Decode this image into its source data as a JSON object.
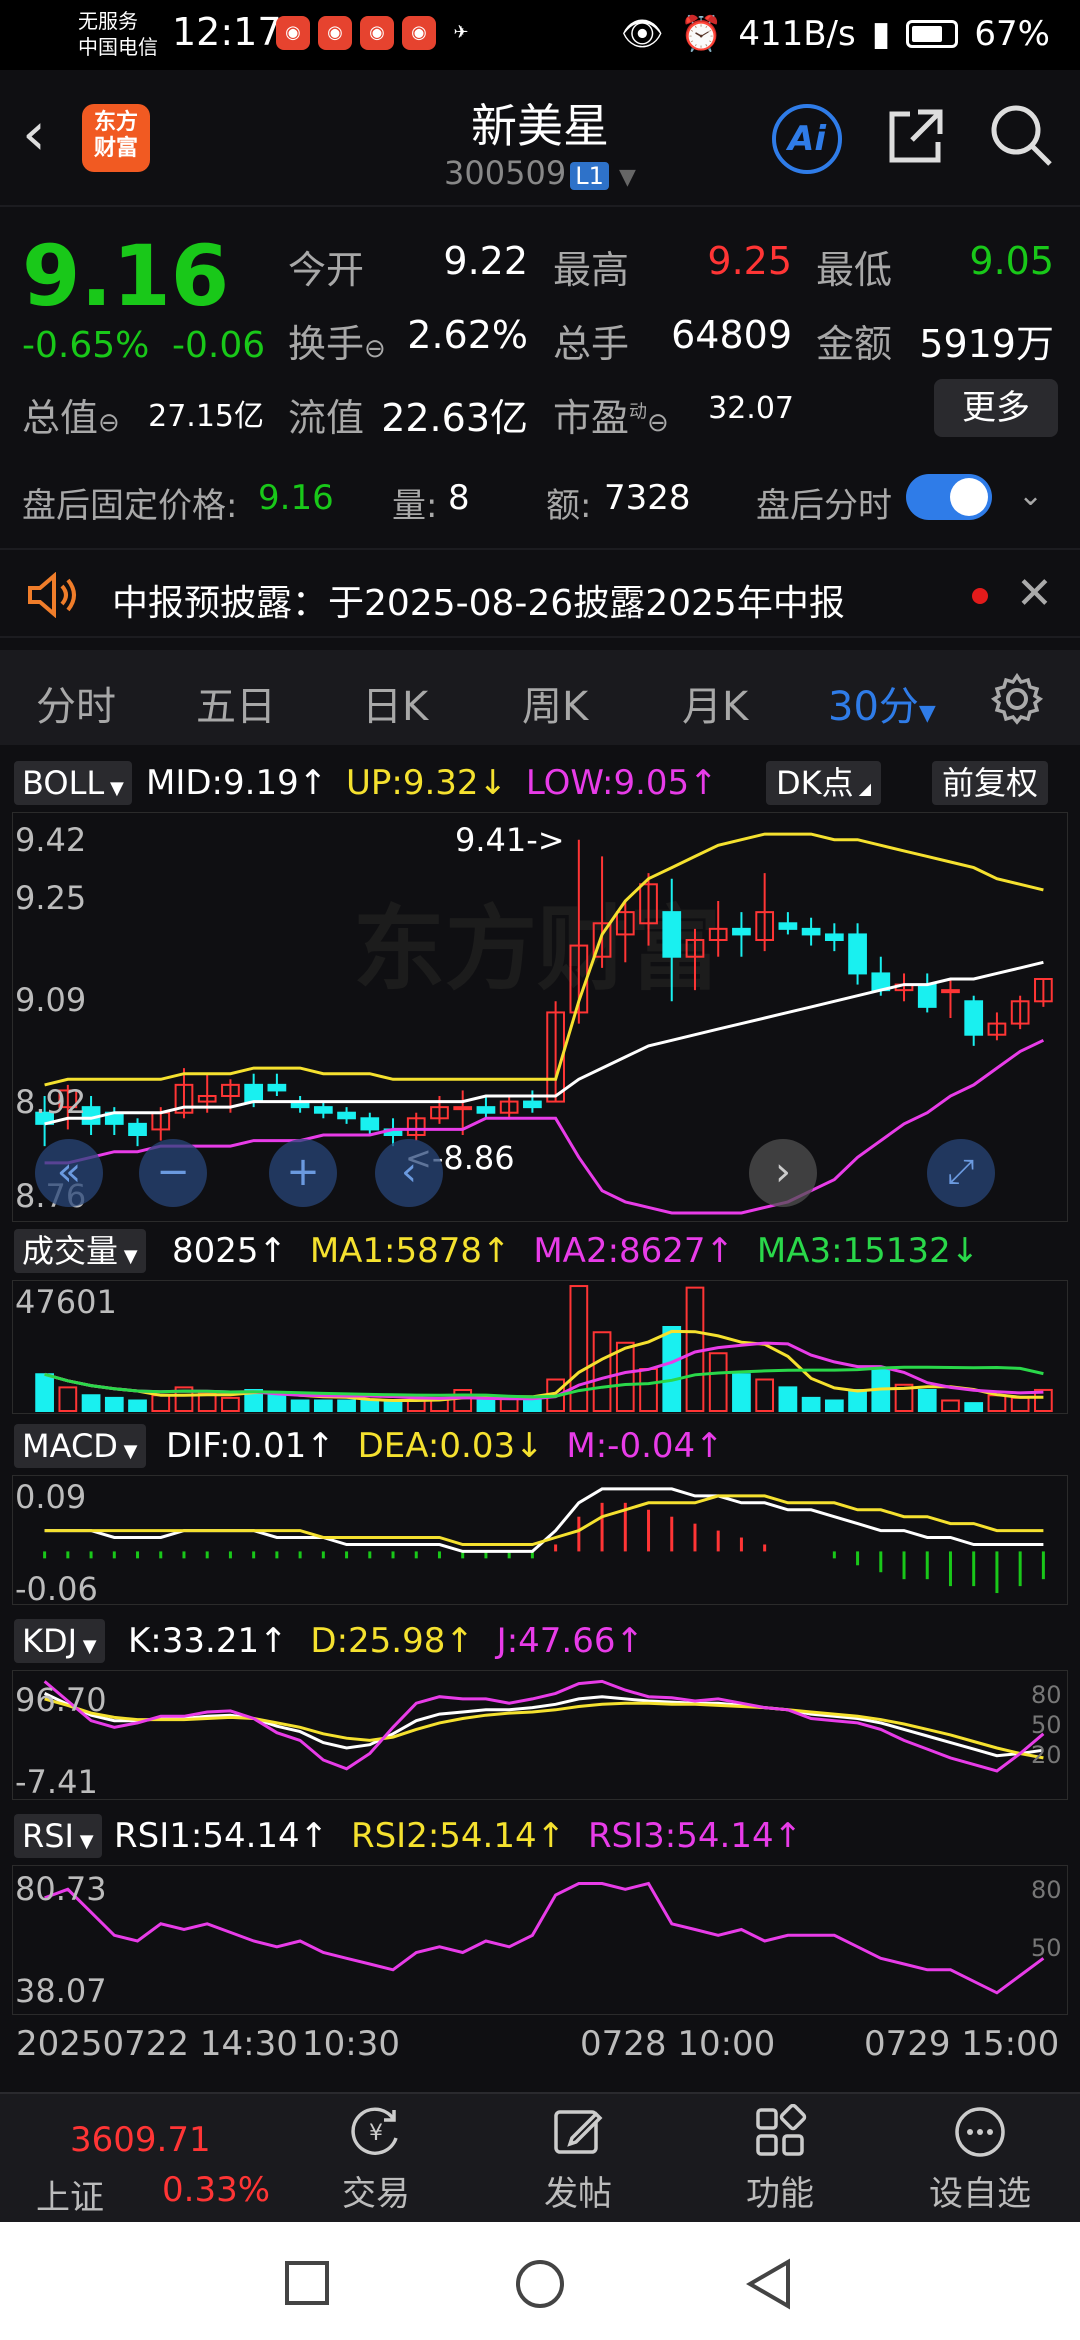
{
  "status_bar": {
    "carrier_line1": "无服务",
    "carrier_line2": "中国电信",
    "time": "12:17",
    "network_speed": "411B/s",
    "battery": "67%"
  },
  "header": {
    "logo_line1": "东方",
    "logo_line2": "财富",
    "stock_name": "新美星",
    "stock_code": "300509",
    "level_badge": "L1",
    "ai_label": "Ai"
  },
  "quote": {
    "price": "9.16",
    "change_pct": "-0.65%",
    "change_abs": "-0.06",
    "open_label": "今开",
    "open": "9.22",
    "high_label": "最高",
    "high": "9.25",
    "low_label": "最低",
    "low": "9.05",
    "turnover_label": "换手",
    "turnover": "2.62%",
    "volume_label": "总手",
    "volume": "64809",
    "amount_label": "金额",
    "amount": "5919万",
    "mktcap_label": "总值",
    "mktcap": "27.15亿",
    "float_label": "流值",
    "float": "22.63亿",
    "pe_label": "市盈",
    "pe_sup": "动",
    "pe": "32.07",
    "more": "更多"
  },
  "after_hours": {
    "price_label": "盘后固定价格:",
    "price": "9.16",
    "vol_label": "量:",
    "vol": "8",
    "amt_label": "额:",
    "amt": "7328",
    "toggle_label": "盘后分时"
  },
  "notice": {
    "text": "中报预披露：于2025-08-26披露2025年中报"
  },
  "tabs": [
    "分时",
    "五日",
    "日K",
    "周K",
    "月K",
    "30分"
  ],
  "boll": {
    "name": "BOLL",
    "mid": "MID:9.19↑",
    "up": "UP:9.32↓",
    "low": "LOW:9.05↑",
    "dk_btn": "DK点",
    "adjust_btn": "前复权",
    "y_ticks": [
      "9.42",
      "9.25",
      "9.09",
      "8.92",
      "8.76"
    ],
    "max_marker": "9.41->",
    "min_marker": "<-8.86",
    "watermark": "东方财富"
  },
  "volume": {
    "name": "成交量",
    "value": "8025↑",
    "ma1": "MA1:5878↑",
    "ma2": "MA2:8627↑",
    "ma3": "MA3:15132↓",
    "y_max": "47601"
  },
  "macd": {
    "name": "MACD",
    "dif": "DIF:0.01↑",
    "dea": "DEA:0.03↓",
    "m": "M:-0.04↑",
    "y_top": "0.09",
    "y_bottom": "-0.06"
  },
  "kdj": {
    "name": "KDJ",
    "k": "K:33.21↑",
    "d": "D:25.98↑",
    "j": "J:47.66↑",
    "y_top": "96.70",
    "y_bottom": "-7.41",
    "r80": "80",
    "r50": "50",
    "r20": "20"
  },
  "rsi": {
    "name": "RSI",
    "rsi1": "RSI1:54.14↑",
    "rsi2": "RSI2:54.14↑",
    "rsi3": "RSI3:54.14↑",
    "y_top": "80.73",
    "y_bottom": "38.07",
    "r80": "80",
    "r50": "50"
  },
  "time_axis": {
    "t1": "20250722 14:30",
    "t2": "10:30",
    "t3": "0728 10:00",
    "t4": "0729 15:00"
  },
  "bottom_bar": {
    "index_value": "3609.71",
    "index_name": "上证",
    "index_pct": "0.33%",
    "trade": "交易",
    "post": "发帖",
    "func": "功能",
    "custom": "设自选"
  },
  "colors": {
    "up": "#ff3535",
    "down": "#19c819",
    "accent": "#2f7ce8",
    "yellow": "#f5e12f",
    "magenta": "#e83ce8",
    "cyan": "#19f0f0"
  },
  "chart_data": {
    "type": "candlestick",
    "interval": "30分",
    "candles_ohlc": [
      [
        8.92,
        8.95,
        8.86,
        8.9
      ],
      [
        8.93,
        8.97,
        8.89,
        8.96
      ],
      [
        8.93,
        8.95,
        8.88,
        8.9
      ],
      [
        8.92,
        8.93,
        8.88,
        8.9
      ],
      [
        8.9,
        8.91,
        8.86,
        8.88
      ],
      [
        8.89,
        8.93,
        8.87,
        8.92
      ],
      [
        8.92,
        9.0,
        8.91,
        8.97
      ],
      [
        8.94,
        8.99,
        8.92,
        8.95
      ],
      [
        8.95,
        8.98,
        8.92,
        8.97
      ],
      [
        8.97,
        8.99,
        8.93,
        8.94
      ],
      [
        8.97,
        8.99,
        8.95,
        8.96
      ],
      [
        8.94,
        8.95,
        8.92,
        8.93
      ],
      [
        8.93,
        8.94,
        8.91,
        8.92
      ],
      [
        8.92,
        8.93,
        8.9,
        8.91
      ],
      [
        8.91,
        8.92,
        8.88,
        8.89
      ],
      [
        8.89,
        8.91,
        8.86,
        8.88
      ],
      [
        8.88,
        8.92,
        8.87,
        8.91
      ],
      [
        8.91,
        8.95,
        8.9,
        8.93
      ],
      [
        8.93,
        8.96,
        8.88,
        8.93
      ],
      [
        8.93,
        8.95,
        8.91,
        8.92
      ],
      [
        8.92,
        8.95,
        8.91,
        8.94
      ],
      [
        8.94,
        8.96,
        8.92,
        8.93
      ],
      [
        8.94,
        9.12,
        8.94,
        9.1
      ],
      [
        9.1,
        9.41,
        9.08,
        9.22
      ],
      [
        9.2,
        9.38,
        9.18,
        9.26
      ],
      [
        9.24,
        9.3,
        9.19,
        9.28
      ],
      [
        9.26,
        9.35,
        9.22,
        9.33
      ],
      [
        9.28,
        9.34,
        9.12,
        9.2
      ],
      [
        9.2,
        9.25,
        9.14,
        9.23
      ],
      [
        9.23,
        9.3,
        9.2,
        9.25
      ],
      [
        9.25,
        9.28,
        9.2,
        9.24
      ],
      [
        9.23,
        9.35,
        9.21,
        9.28
      ],
      [
        9.26,
        9.28,
        9.24,
        9.25
      ],
      [
        9.25,
        9.27,
        9.22,
        9.24
      ],
      [
        9.24,
        9.26,
        9.21,
        9.23
      ],
      [
        9.24,
        9.26,
        9.15,
        9.17
      ],
      [
        9.17,
        9.2,
        9.13,
        9.14
      ],
      [
        9.14,
        9.17,
        9.12,
        9.15
      ],
      [
        9.15,
        9.17,
        9.1,
        9.11
      ],
      [
        9.14,
        9.16,
        9.09,
        9.14
      ],
      [
        9.12,
        9.13,
        9.04,
        9.06
      ],
      [
        9.06,
        9.1,
        9.05,
        9.08
      ],
      [
        9.08,
        9.13,
        9.07,
        9.12
      ],
      [
        9.12,
        9.16,
        9.11,
        9.16
      ]
    ],
    "boll_mid": [
      8.9,
      8.91,
      8.91,
      8.92,
      8.92,
      8.92,
      8.93,
      8.93,
      8.93,
      8.94,
      8.94,
      8.94,
      8.94,
      8.94,
      8.94,
      8.94,
      8.94,
      8.94,
      8.94,
      8.95,
      8.95,
      8.95,
      8.95,
      8.98,
      9.0,
      9.02,
      9.04,
      9.05,
      9.06,
      9.07,
      9.08,
      9.09,
      9.1,
      9.11,
      9.12,
      9.13,
      9.14,
      9.15,
      9.15,
      9.16,
      9.16,
      9.17,
      9.18,
      9.19
    ],
    "boll_up": [
      8.97,
      8.98,
      8.98,
      8.98,
      8.98,
      8.98,
      8.99,
      8.99,
      8.99,
      9.0,
      9.0,
      9.0,
      8.99,
      8.99,
      8.99,
      8.98,
      8.98,
      8.98,
      8.98,
      8.98,
      8.98,
      8.98,
      8.98,
      9.12,
      9.24,
      9.3,
      9.34,
      9.36,
      9.38,
      9.4,
      9.41,
      9.42,
      9.42,
      9.42,
      9.41,
      9.41,
      9.4,
      9.39,
      9.38,
      9.37,
      9.36,
      9.34,
      9.33,
      9.32
    ],
    "boll_low": [
      8.83,
      8.83,
      8.84,
      8.85,
      8.85,
      8.86,
      8.86,
      8.86,
      8.86,
      8.87,
      8.87,
      8.87,
      8.88,
      8.88,
      8.88,
      8.89,
      8.89,
      8.89,
      8.89,
      8.91,
      8.91,
      8.91,
      8.91,
      8.84,
      8.78,
      8.76,
      8.75,
      8.74,
      8.74,
      8.74,
      8.74,
      8.75,
      8.76,
      8.78,
      8.8,
      8.84,
      8.87,
      8.9,
      8.92,
      8.95,
      8.97,
      9.0,
      9.03,
      9.05
    ],
    "volumes": [
      14000,
      9000,
      6000,
      5000,
      4000,
      6000,
      9000,
      7000,
      5000,
      8000,
      6000,
      4000,
      4000,
      4000,
      4000,
      4000,
      4000,
      5000,
      8000,
      5000,
      5000,
      4000,
      12000,
      47601,
      30000,
      26000,
      16000,
      32000,
      47000,
      22000,
      14000,
      12000,
      9000,
      5000,
      4000,
      8000,
      16000,
      10000,
      8000,
      4000,
      3000,
      6000,
      5000,
      8025
    ],
    "macd_hist": [
      -0.01,
      -0.01,
      -0.01,
      -0.01,
      -0.01,
      -0.01,
      -0.01,
      -0.01,
      -0.01,
      -0.01,
      -0.01,
      -0.01,
      -0.01,
      -0.01,
      -0.01,
      -0.01,
      -0.01,
      -0.01,
      -0.01,
      -0.01,
      -0.01,
      -0.01,
      0.01,
      0.05,
      0.07,
      0.07,
      0.06,
      0.05,
      0.04,
      0.03,
      0.02,
      0.01,
      0.0,
      0.0,
      -0.01,
      -0.02,
      -0.03,
      -0.04,
      -0.04,
      -0.05,
      -0.05,
      -0.06,
      -0.05,
      -0.04
    ],
    "macd_dif": [
      0.03,
      0.03,
      0.03,
      0.02,
      0.02,
      0.02,
      0.03,
      0.03,
      0.03,
      0.03,
      0.02,
      0.02,
      0.02,
      0.01,
      0.01,
      0.01,
      0.01,
      0.01,
      0.0,
      0.0,
      0.0,
      0.0,
      0.03,
      0.07,
      0.09,
      0.09,
      0.09,
      0.09,
      0.08,
      0.08,
      0.07,
      0.07,
      0.06,
      0.06,
      0.05,
      0.04,
      0.03,
      0.03,
      0.02,
      0.02,
      0.01,
      0.01,
      0.01,
      0.01
    ],
    "macd_dea": [
      0.03,
      0.03,
      0.03,
      0.03,
      0.03,
      0.03,
      0.03,
      0.03,
      0.03,
      0.03,
      0.03,
      0.03,
      0.02,
      0.02,
      0.02,
      0.02,
      0.02,
      0.02,
      0.01,
      0.01,
      0.01,
      0.01,
      0.02,
      0.03,
      0.05,
      0.06,
      0.07,
      0.07,
      0.07,
      0.08,
      0.08,
      0.08,
      0.07,
      0.07,
      0.07,
      0.06,
      0.06,
      0.05,
      0.05,
      0.04,
      0.04,
      0.03,
      0.03,
      0.03
    ],
    "kdj_k": [
      85,
      75,
      65,
      60,
      60,
      62,
      62,
      64,
      65,
      62,
      55,
      50,
      40,
      35,
      38,
      48,
      60,
      66,
      68,
      70,
      70,
      72,
      75,
      80,
      82,
      80,
      78,
      77,
      76,
      76,
      74,
      72,
      70,
      66,
      64,
      62,
      58,
      52,
      46,
      40,
      34,
      28,
      30,
      33
    ],
    "kdj_d": [
      80,
      74,
      67,
      63,
      61,
      61,
      61,
      62,
      63,
      62,
      58,
      54,
      48,
      44,
      42,
      45,
      52,
      58,
      62,
      65,
      67,
      68,
      70,
      73,
      75,
      76,
      76,
      75,
      75,
      74,
      73,
      72,
      70,
      68,
      66,
      64,
      61,
      57,
      52,
      47,
      41,
      35,
      30,
      26
    ],
    "kdj_j": [
      96,
      78,
      60,
      54,
      58,
      64,
      64,
      68,
      69,
      62,
      49,
      42,
      24,
      16,
      30,
      54,
      76,
      82,
      80,
      80,
      76,
      80,
      85,
      94,
      96,
      88,
      82,
      81,
      78,
      80,
      76,
      72,
      70,
      62,
      60,
      58,
      52,
      42,
      34,
      26,
      20,
      14,
      30,
      48
    ],
    "rsi": [
      75,
      78,
      70,
      62,
      60,
      66,
      64,
      66,
      63,
      60,
      58,
      60,
      56,
      54,
      52,
      50,
      56,
      58,
      56,
      60,
      58,
      62,
      76,
      80,
      80,
      78,
      80,
      66,
      64,
      62,
      64,
      60,
      62,
      62,
      62,
      58,
      54,
      52,
      50,
      50,
      46,
      42,
      48,
      54
    ]
  }
}
